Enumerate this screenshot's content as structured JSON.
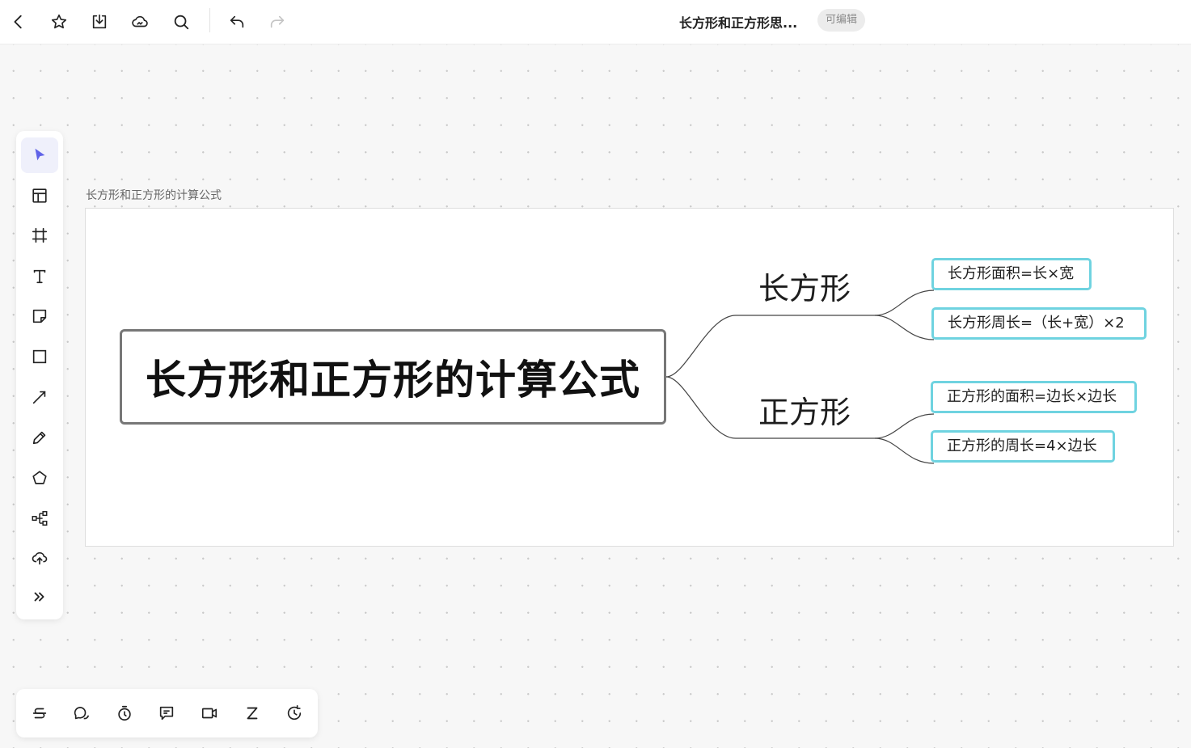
{
  "header": {
    "title": "长方形和正方形思...",
    "edit_badge": "可编辑",
    "icons": [
      "back-icon",
      "star-icon",
      "download-icon",
      "cloud-icon",
      "search-icon",
      "undo-icon",
      "redo-icon"
    ]
  },
  "left_toolbar": {
    "tools": [
      "select-icon",
      "template-icon",
      "frame-icon",
      "text-icon",
      "sticky-note-icon",
      "rectangle-icon",
      "arrow-line-icon",
      "pen-icon",
      "polygon-icon",
      "mindmap-icon",
      "upload-icon",
      "expand-icon"
    ],
    "active_tool": "select-icon",
    "accent_color": "#6063e8"
  },
  "bottom_toolbar": {
    "tools": [
      "strikethrough-icon",
      "comments-icon",
      "timer-icon",
      "message-icon",
      "video-icon",
      "sleep-icon",
      "history-icon"
    ]
  },
  "canvas": {
    "frame_label": "长方形和正方形的计算公式",
    "mindmap": {
      "root": "长方形和正方形的计算公式",
      "branches": [
        {
          "label": "长方形",
          "children": [
            "长方形面积=长×宽",
            "长方形周长=（长+宽）×2"
          ]
        },
        {
          "label": "正方形",
          "children": [
            "正方形的面积=边长×边长",
            "正方形的周长=4×边长"
          ]
        }
      ],
      "leaf_border_color": "#6fd3e0",
      "root_border_color": "#777777"
    }
  }
}
